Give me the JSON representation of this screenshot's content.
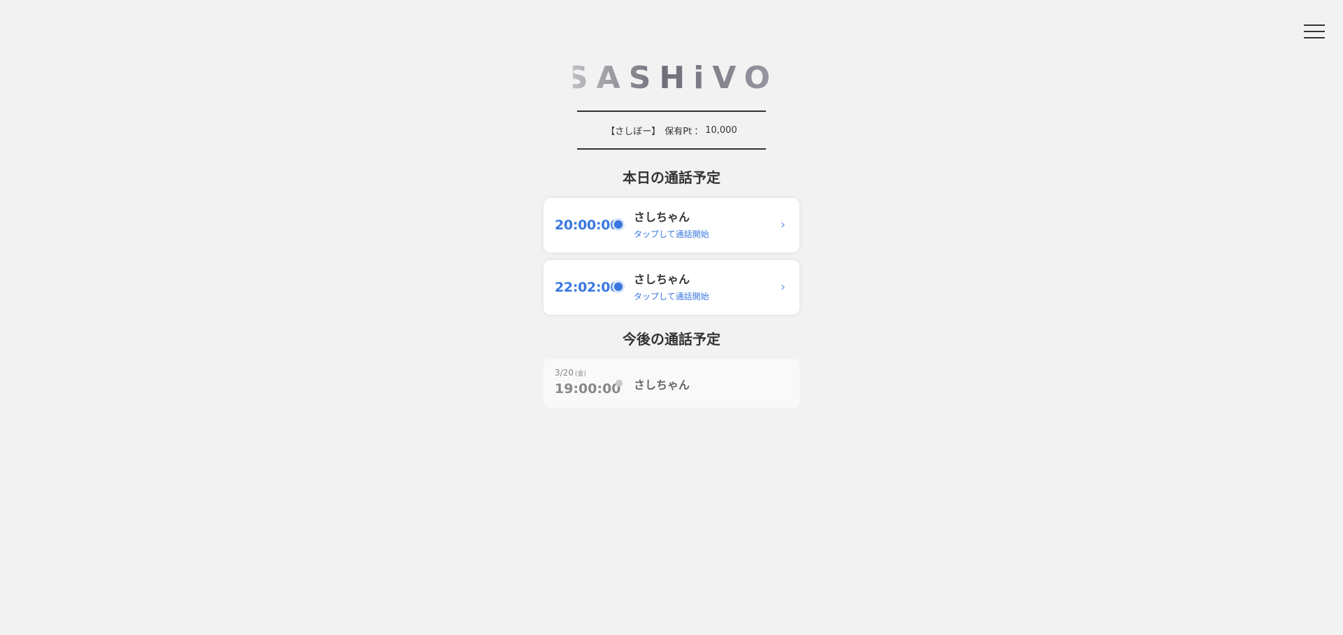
{
  "header": {
    "logo_text": "SASHiVO",
    "menu_icon": "hamburger-menu-icon"
  },
  "points": {
    "nickname": "【さしぼー】",
    "label": "保有Pt",
    "separator": "：",
    "value": "10,000"
  },
  "today": {
    "title": "本日の通話予定",
    "calls": [
      {
        "time": "20:00:00",
        "name": "さしちゃん",
        "action": "タップして通話開始"
      },
      {
        "time": "22:02:00",
        "name": "さしちゃん",
        "action": "タップして通話開始"
      }
    ]
  },
  "future": {
    "title": "今後の通話予定",
    "calls": [
      {
        "date": "3/20",
        "day": "(金)",
        "time": "19:00:00",
        "name": "さしちゃん"
      }
    ]
  },
  "colors": {
    "accent": "#3a78e0",
    "background": "#f2f2f2"
  }
}
